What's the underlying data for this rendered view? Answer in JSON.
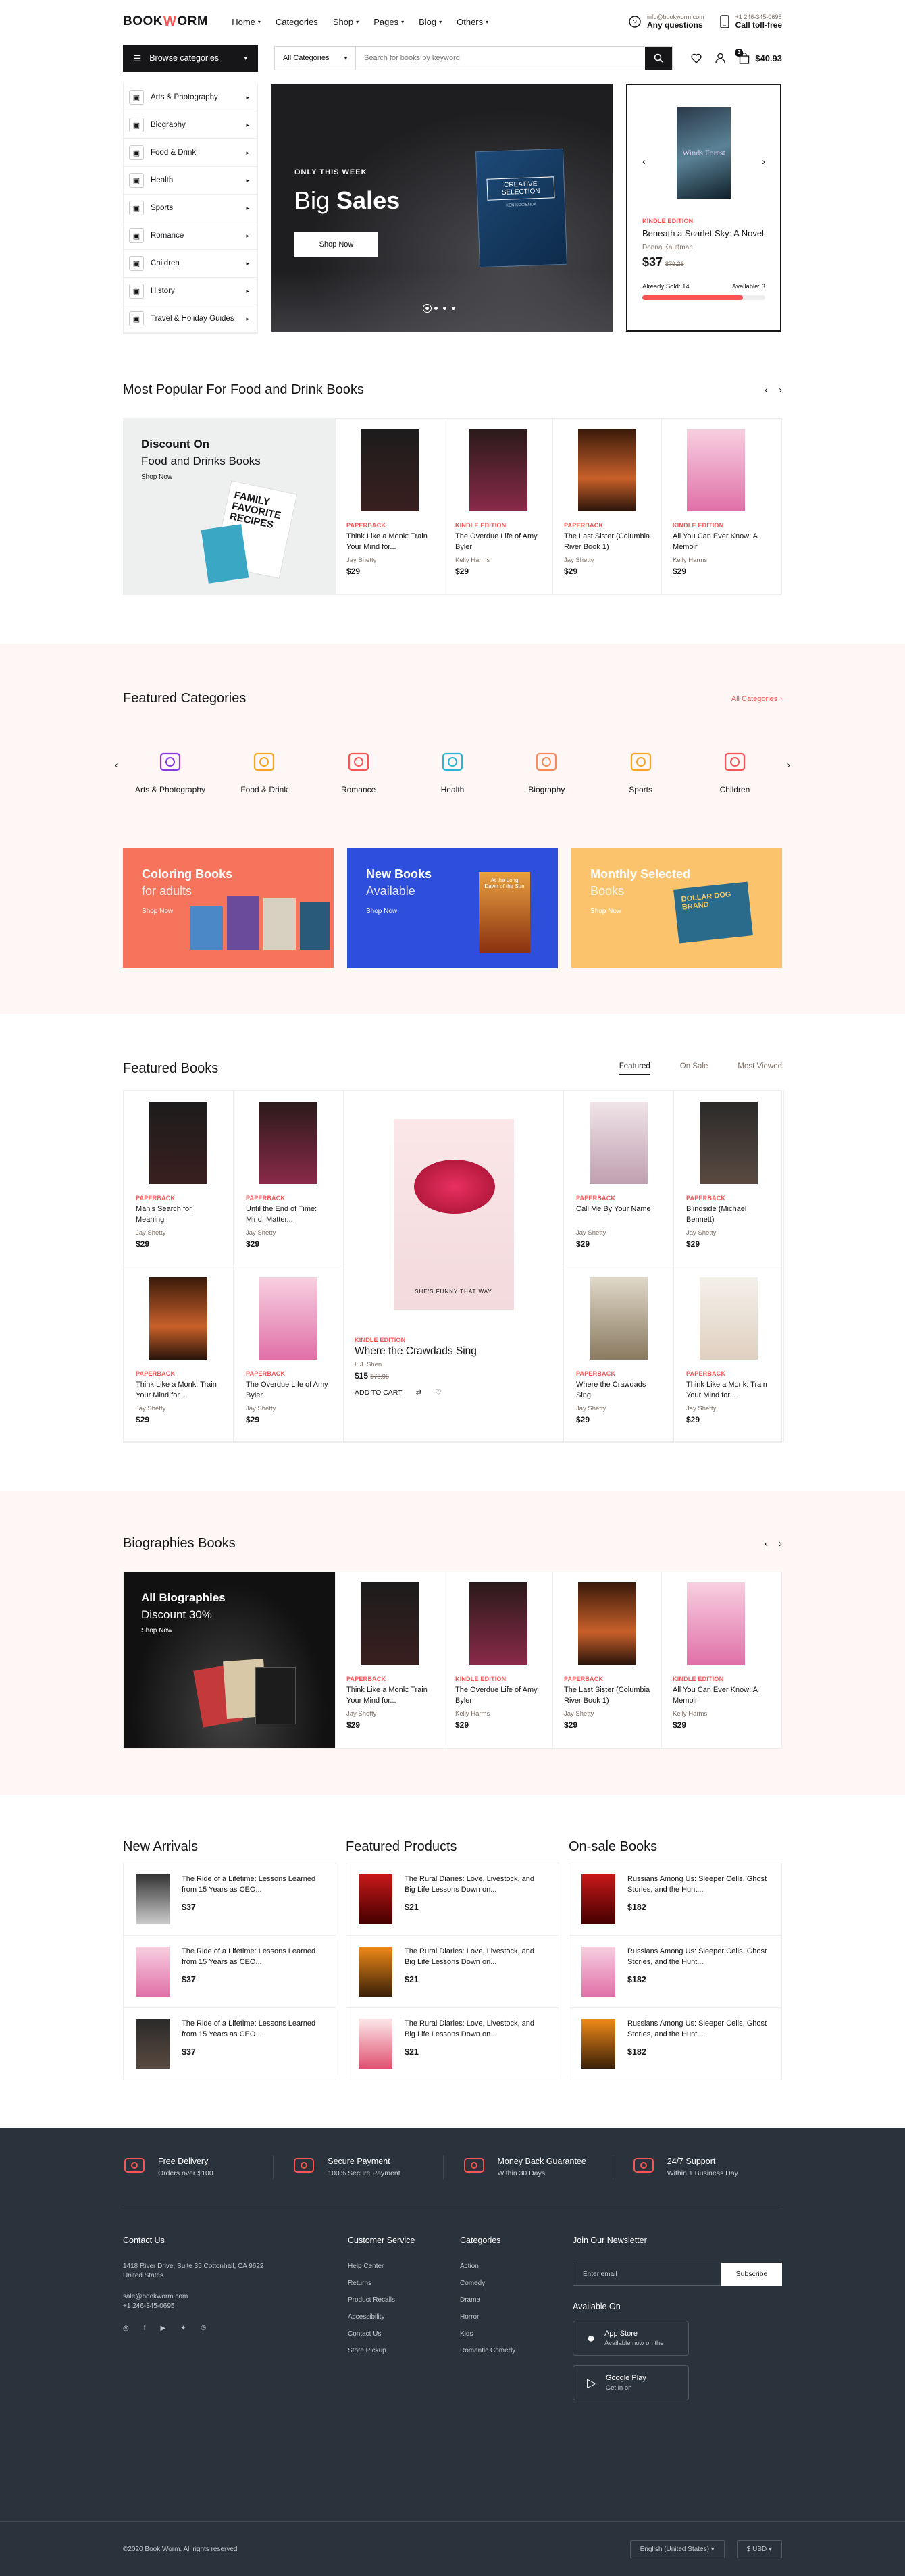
{
  "header": {
    "logo_left": "BOOK",
    "logo_right": "ORM",
    "nav": [
      "Home",
      "Categories",
      "Shop",
      "Pages",
      "Blog",
      "Others"
    ],
    "email": "info@bookworm.com",
    "email_label": "Any questions",
    "phone": "+1 246-345-0695",
    "phone_label": "Call toll-free"
  },
  "search": {
    "browse": "Browse categories",
    "category": "All Categories",
    "placeholder": "Search for books by keyword",
    "cart_total": "$40.93",
    "cart_count": "3"
  },
  "categories": [
    "Arts & Photography",
    "Biography",
    "Food & Drink",
    "Health",
    "Sports",
    "Romance",
    "Children",
    "History",
    "Travel & Holiday Guides"
  ],
  "hero": {
    "eyebrow": "ONLY THIS WEEK",
    "title_a": "Big",
    "title_b": "Sales",
    "button": "Shop Now",
    "book_title": "CREATIVE SELECTION",
    "book_author": "KEN KOCIENDA"
  },
  "deal": {
    "cover_text": "Winds Forest",
    "tag": "KINDLE EDITION",
    "title": "Beneath a Scarlet Sky: A Novel",
    "author": "Donna Kauffman",
    "price": "$37",
    "old_price": "$79.26",
    "sold": "Already Sold: 14",
    "available": "Available: 3",
    "progress": 0.82
  },
  "popular": {
    "heading": "Most Popular For Food and Drink Books",
    "promo_a": "Discount On",
    "promo_b": "Food and Drinks Books",
    "promo_link": "Shop Now",
    "promo_book": "FAMILY FAVORITE RECIPES",
    "books": [
      {
        "tag": "PAPERBACK",
        "title": "Think Like a Monk: Train Your Mind for...",
        "author": "Jay Shetty",
        "price": "$29",
        "cover": "avenir"
      },
      {
        "tag": "KINDLE EDITION",
        "title": "The Overdue Life of Amy Byler",
        "author": "Kelly Harms",
        "price": "$29",
        "cover": "dark"
      },
      {
        "tag": "PAPERBACK",
        "title": "The Last Sister (Columbia River Book 1)",
        "author": "Jay Shetty",
        "price": "$29",
        "cover": "orange"
      },
      {
        "tag": "KINDLE EDITION",
        "title": "All You Can Ever Know: A Memoir",
        "author": "Kelly Harms",
        "price": "$29",
        "cover": "pink"
      }
    ]
  },
  "featured_categories": {
    "heading": "Featured Categories",
    "all_link": "All Categories",
    "items": [
      "Arts & Photography",
      "Food & Drink",
      "Romance",
      "Health",
      "Biography",
      "Sports",
      "Children"
    ]
  },
  "tiles": [
    {
      "t1": "Coloring Books",
      "t2": "for adults",
      "t3": "Shop Now"
    },
    {
      "t1": "New Books",
      "t2": "Available",
      "t3": "Shop Now",
      "book": "At the Long Dawn of the Sun"
    },
    {
      "t1": "Monthly Selected",
      "t2": "Books",
      "t3": "Shop Now",
      "book": "DOLLAR DOG BRAND"
    }
  ],
  "featured_books": {
    "heading": "Featured Books",
    "tabs": [
      "Featured",
      "On Sale",
      "Most Viewed"
    ],
    "grid": [
      {
        "tag": "PAPERBACK",
        "title": "Man's Search for Meaning",
        "author": "Jay Shetty",
        "price": "$29",
        "cover": "avenir"
      },
      {
        "tag": "PAPERBACK",
        "title": "Until the End of Time: Mind, Matter...",
        "author": "Jay Shetty",
        "price": "$29",
        "cover": "dark"
      },
      {
        "tag": "PAPERBACK",
        "title": "Call Me By Your Name",
        "author": "Jay Shetty",
        "price": "$29",
        "cover": "enjoy"
      },
      {
        "tag": "PAPERBACK",
        "title": "Blindside (Michael Bennett)",
        "author": "Jay Shetty",
        "price": "$29",
        "cover": "foreman"
      },
      {
        "tag": "PAPERBACK",
        "title": "Think Like a Monk: Train Your Mind for...",
        "author": "Jay Shetty",
        "price": "$29",
        "cover": "orange"
      },
      {
        "tag": "PAPERBACK",
        "title": "The Overdue Life of Amy Byler",
        "author": "Jay Shetty",
        "price": "$29",
        "cover": "pink"
      },
      {
        "tag": "PAPERBACK",
        "title": "Where the Crawdads Sing",
        "author": "Jay Shetty",
        "price": "$29",
        "cover": "wall"
      },
      {
        "tag": "PAPERBACK",
        "title": "Think Like a Monk: Train Your Mind for...",
        "author": "Jay Shetty",
        "price": "$29",
        "cover": "coco"
      }
    ],
    "big": {
      "cover_small": "SHE'S FUNNY THAT WAY",
      "tag": "KINDLE EDITION",
      "title": "Where the Crawdads Sing",
      "author": "L.J. Shen",
      "price": "$15",
      "old_price": "$78.96",
      "add": "ADD TO CART"
    }
  },
  "biographies": {
    "heading": "Biographies Books",
    "promo_a": "All Biographies",
    "promo_b": "Discount 30%",
    "promo_link": "Shop Now",
    "books": [
      {
        "tag": "PAPERBACK",
        "title": "Think Like a Monk: Train Your Mind for...",
        "author": "Jay Shetty",
        "price": "$29",
        "cover": "avenir"
      },
      {
        "tag": "KINDLE EDITION",
        "title": "The Overdue Life of Amy Byler",
        "author": "Kelly Harms",
        "price": "$29",
        "cover": "dark"
      },
      {
        "tag": "PAPERBACK",
        "title": "The Last Sister (Columbia River Book 1)",
        "author": "Jay Shetty",
        "price": "$29",
        "cover": "orange"
      },
      {
        "tag": "KINDLE EDITION",
        "title": "All You Can Ever Know: A Memoir",
        "author": "Kelly Harms",
        "price": "$29",
        "cover": "pink"
      }
    ]
  },
  "lists": [
    {
      "heading": "New Arrivals",
      "items": [
        {
          "title": "The Ride of a Lifetime: Lessons Learned from 15 Years as CEO...",
          "price": "$37",
          "cover": "ok"
        },
        {
          "title": "The Ride of a Lifetime: Lessons Learned from 15 Years as CEO...",
          "price": "$37",
          "cover": "pink"
        },
        {
          "title": "The Ride of a Lifetime: Lessons Learned from 15 Years as CEO...",
          "price": "$37",
          "cover": "foreman"
        }
      ]
    },
    {
      "heading": "Featured Products",
      "items": [
        {
          "title": "The Rural Diaries: Love, Livestock, and Big Life Lessons Down on...",
          "price": "$21",
          "cover": "beast"
        },
        {
          "title": "The Rural Diaries: Love, Livestock, and Big Life Lessons Down on...",
          "price": "$21",
          "cover": "amber"
        },
        {
          "title": "The Rural Diaries: Love, Livestock, and Big Life Lessons Down on...",
          "price": "$21",
          "cover": "lips"
        }
      ]
    },
    {
      "heading": "On-sale Books",
      "items": [
        {
          "title": "Russians Among Us: Sleeper Cells, Ghost Stories, and the Hunt...",
          "price": "$182",
          "cover": "beast"
        },
        {
          "title": "Russians Among Us: Sleeper Cells, Ghost Stories, and the Hunt...",
          "price": "$182",
          "cover": "pink"
        },
        {
          "title": "Russians Among Us: Sleeper Cells, Ghost Stories, and the Hunt...",
          "price": "$182",
          "cover": "amber"
        }
      ]
    }
  ],
  "footer": {
    "features": [
      {
        "t": "Free Delivery",
        "s": "Orders over $100"
      },
      {
        "t": "Secure Payment",
        "s": "100% Secure Payment"
      },
      {
        "t": "Money Back Guarantee",
        "s": "Within 30 Days"
      },
      {
        "t": "24/7 Support",
        "s": "Within 1 Business Day"
      }
    ],
    "contact_h": "Contact Us",
    "address1": "1418 River Drive, Suite 35 Cottonhall, CA 9622",
    "address2": "United States",
    "email": "sale@bookworm.com",
    "phone": "+1 246-345-0695",
    "service_h": "Customer Service",
    "service": [
      "Help Center",
      "Returns",
      "Product Recalls",
      "Accessibility",
      "Contact Us",
      "Store Pickup"
    ],
    "cat_h": "Categories",
    "cats": [
      "Action",
      "Comedy",
      "Drama",
      "Horror",
      "Kids",
      "Romantic Comedy"
    ],
    "news_h": "Join Our Newsletter",
    "news_placeholder": "Enter email",
    "subscribe": "Subscribe",
    "avail_h": "Available On",
    "stores": [
      {
        "a": "App Store",
        "b": "Available now on the"
      },
      {
        "a": "Google Play",
        "b": "Get in on"
      }
    ],
    "copyright": "©2020 Book Worm. All rights reserved",
    "lang": "English (United States)",
    "currency": "$ USD"
  },
  "colors": {
    "accent": "#f75454",
    "dark": "#161619",
    "footer": "#2a323c",
    "pink_bg": "#fff6f6",
    "tile1": "#f6735c",
    "tile2": "#2d4fdc",
    "tile3": "#fbc46c"
  }
}
